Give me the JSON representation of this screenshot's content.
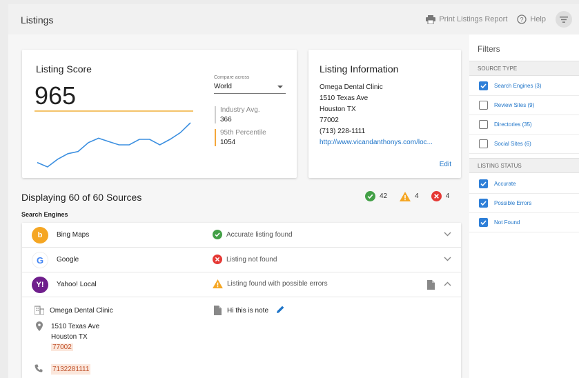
{
  "header": {
    "title": "Listings",
    "print_label": "Print Listings Report",
    "help_label": "Help"
  },
  "score": {
    "title": "Listing Score",
    "value": "965",
    "compare_label": "Compare across",
    "compare_value": "World",
    "industry_label": "Industry Avg.",
    "industry_value": "366",
    "percentile_label": "95th Percentile",
    "percentile_value": "1054",
    "trend": [
      6,
      2,
      9,
      14,
      16,
      24,
      28,
      25,
      22,
      22,
      27,
      27,
      22,
      27,
      33,
      42
    ]
  },
  "info": {
    "title": "Listing Information",
    "name": "Omega Dental Clinic",
    "street": "1510 Texas Ave",
    "city": "Houston TX",
    "zip": "77002",
    "phone": "(713) 228-1111",
    "url": "http://www.vicandanthonys.com/loc...",
    "edit_label": "Edit"
  },
  "summary": {
    "displaying": "Displaying 60 of 60 Sources",
    "accurate_count": "42",
    "warning_count": "4",
    "error_count": "4",
    "section_label": "Search Engines"
  },
  "sources": [
    {
      "name": "Bing Maps",
      "status": "Accurate listing found",
      "logo_text": "b",
      "color": "#f5a623"
    },
    {
      "name": "Google",
      "status": "Listing not found",
      "logo_text": "G",
      "color": "#4285f4"
    },
    {
      "name": "Yahoo! Local",
      "status": "Listing found with possible errors",
      "logo_text": "Y!",
      "color": "#6f1e8c"
    }
  ],
  "detail": {
    "name": "Omega Dental Clinic",
    "street": "1510 Texas Ave",
    "city": "Houston TX",
    "zip": "77002",
    "phone": "7132281111",
    "note": "Hi this is note"
  },
  "filters": {
    "title": "Filters",
    "source_type_label": "SOURCE TYPE",
    "source_types": [
      {
        "label": "Search Engines (3)",
        "checked": true
      },
      {
        "label": "Review Sites (9)",
        "checked": false
      },
      {
        "label": "Directories (35)",
        "checked": false
      },
      {
        "label": "Social Sites (6)",
        "checked": false
      }
    ],
    "status_label": "LISTING STATUS",
    "statuses": [
      {
        "label": "Accurate",
        "checked": true
      },
      {
        "label": "Possible Errors",
        "checked": true
      },
      {
        "label": "Not Found",
        "checked": true
      }
    ]
  },
  "colors": {
    "accent": "#1e74c8",
    "success": "#43a047",
    "warning": "#f5a623",
    "error": "#e53935",
    "score_line": "#f4c36a"
  }
}
